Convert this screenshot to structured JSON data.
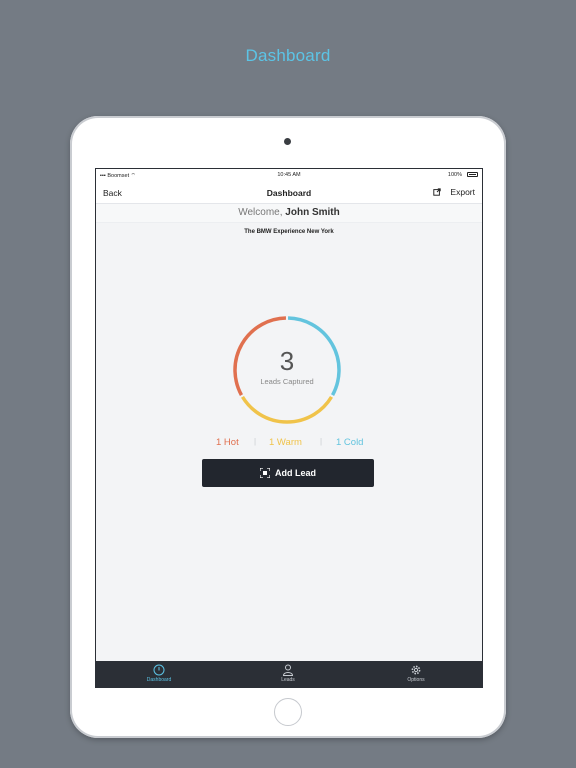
{
  "hero": {
    "title": "Dashboard"
  },
  "statusbar": {
    "carrier": "Boomset",
    "time": "10:45 AM",
    "battery": "100%"
  },
  "navbar": {
    "back_label": "Back",
    "title": "Dashboard",
    "export_label": "Export"
  },
  "welcome": {
    "prefix": "Welcome,",
    "name": "John Smith"
  },
  "venue": "The BMW Experience New York",
  "summary": {
    "total": "3",
    "caption": "Leads Captured",
    "hot_label": "1 Hot",
    "warm_label": "1 Warm",
    "cold_label": "1 Cold",
    "separator": "|"
  },
  "donut": {
    "segments": [
      {
        "name": "Hot",
        "value": 1,
        "color": "#e0704f"
      },
      {
        "name": "Warm",
        "value": 1,
        "color": "#f0c34a"
      },
      {
        "name": "Cold",
        "value": 1,
        "color": "#63c4de"
      }
    ]
  },
  "actions": {
    "add_lead_label": "Add Lead"
  },
  "tabs": [
    {
      "label": "Dashboard",
      "icon": "dashboard-icon",
      "active": true
    },
    {
      "label": "Leads",
      "icon": "person-icon",
      "active": false
    },
    {
      "label": "Options",
      "icon": "gear-icon",
      "active": false
    }
  ],
  "colors": {
    "accent": "#5cc4e6",
    "tabbar": "#2b2f36",
    "button": "#22262e"
  }
}
